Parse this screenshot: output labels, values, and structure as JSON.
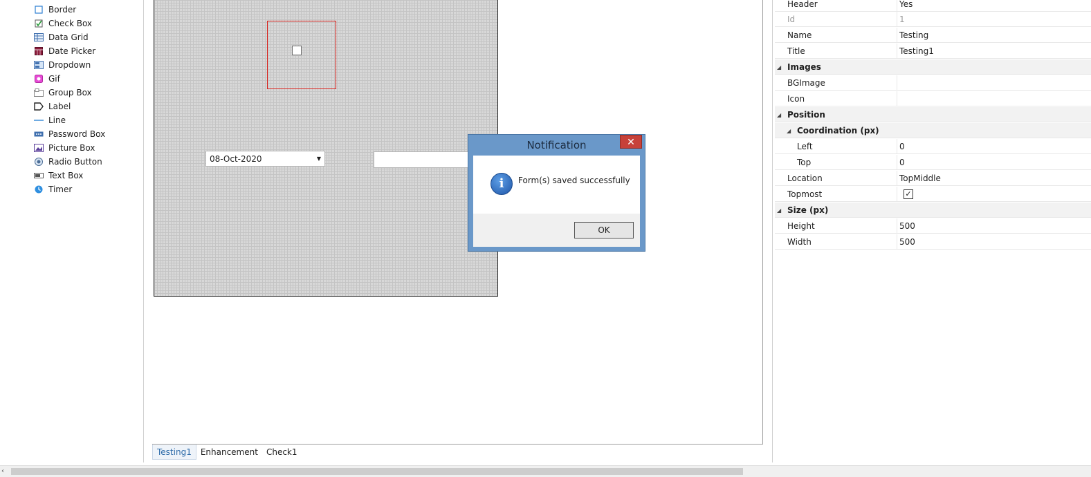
{
  "toolbox": {
    "items": [
      {
        "label": "Border",
        "icon": "border-icon"
      },
      {
        "label": "Check Box",
        "icon": "checkbox-icon"
      },
      {
        "label": "Data Grid",
        "icon": "datagrid-icon"
      },
      {
        "label": "Date Picker",
        "icon": "datepicker-icon"
      },
      {
        "label": "Dropdown",
        "icon": "dropdown-icon"
      },
      {
        "label": "Gif",
        "icon": "gif-icon"
      },
      {
        "label": "Group Box",
        "icon": "groupbox-icon"
      },
      {
        "label": "Label",
        "icon": "label-icon"
      },
      {
        "label": "Line",
        "icon": "line-icon"
      },
      {
        "label": "Password Box",
        "icon": "passwordbox-icon"
      },
      {
        "label": "Picture Box",
        "icon": "picturebox-icon"
      },
      {
        "label": "Radio Button",
        "icon": "radiobutton-icon"
      },
      {
        "label": "Text Box",
        "icon": "textbox-icon"
      },
      {
        "label": "Timer",
        "icon": "timer-icon"
      }
    ]
  },
  "designer": {
    "date_picker_value": "08-Oct-2020",
    "tabs": [
      "Testing1",
      "Enhancement",
      "Check1"
    ],
    "active_tab": "Testing1"
  },
  "properties": {
    "header": {
      "name": "Header",
      "value": "Yes"
    },
    "id": {
      "name": "Id",
      "value": "1"
    },
    "name": {
      "name": "Name",
      "value": "Testing"
    },
    "title": {
      "name": "Title",
      "value": "Testing1"
    },
    "images_cat": "Images",
    "bgimage": {
      "name": "BGImage",
      "value": ""
    },
    "icon": {
      "name": "Icon",
      "value": ""
    },
    "position_cat": "Position",
    "coordination_cat": "Coordination (px)",
    "left": {
      "name": "Left",
      "value": "0"
    },
    "top": {
      "name": "Top",
      "value": "0"
    },
    "location": {
      "name": "Location",
      "value": "TopMiddle"
    },
    "topmost": {
      "name": "Topmost",
      "checked": true
    },
    "size_cat": "Size (px)",
    "height": {
      "name": "Height",
      "value": "500"
    },
    "width": {
      "name": "Width",
      "value": "500"
    }
  },
  "dialog": {
    "title": "Notification",
    "message": "Form(s) saved successfully",
    "ok_label": "OK",
    "close_glyph": "✕",
    "info_glyph": "i"
  },
  "colors": {
    "dialog_frame": "#6a98c9",
    "close_button": "#c7413a",
    "selection_border": "#d9201b",
    "active_tab_text": "#2c6aa8"
  }
}
